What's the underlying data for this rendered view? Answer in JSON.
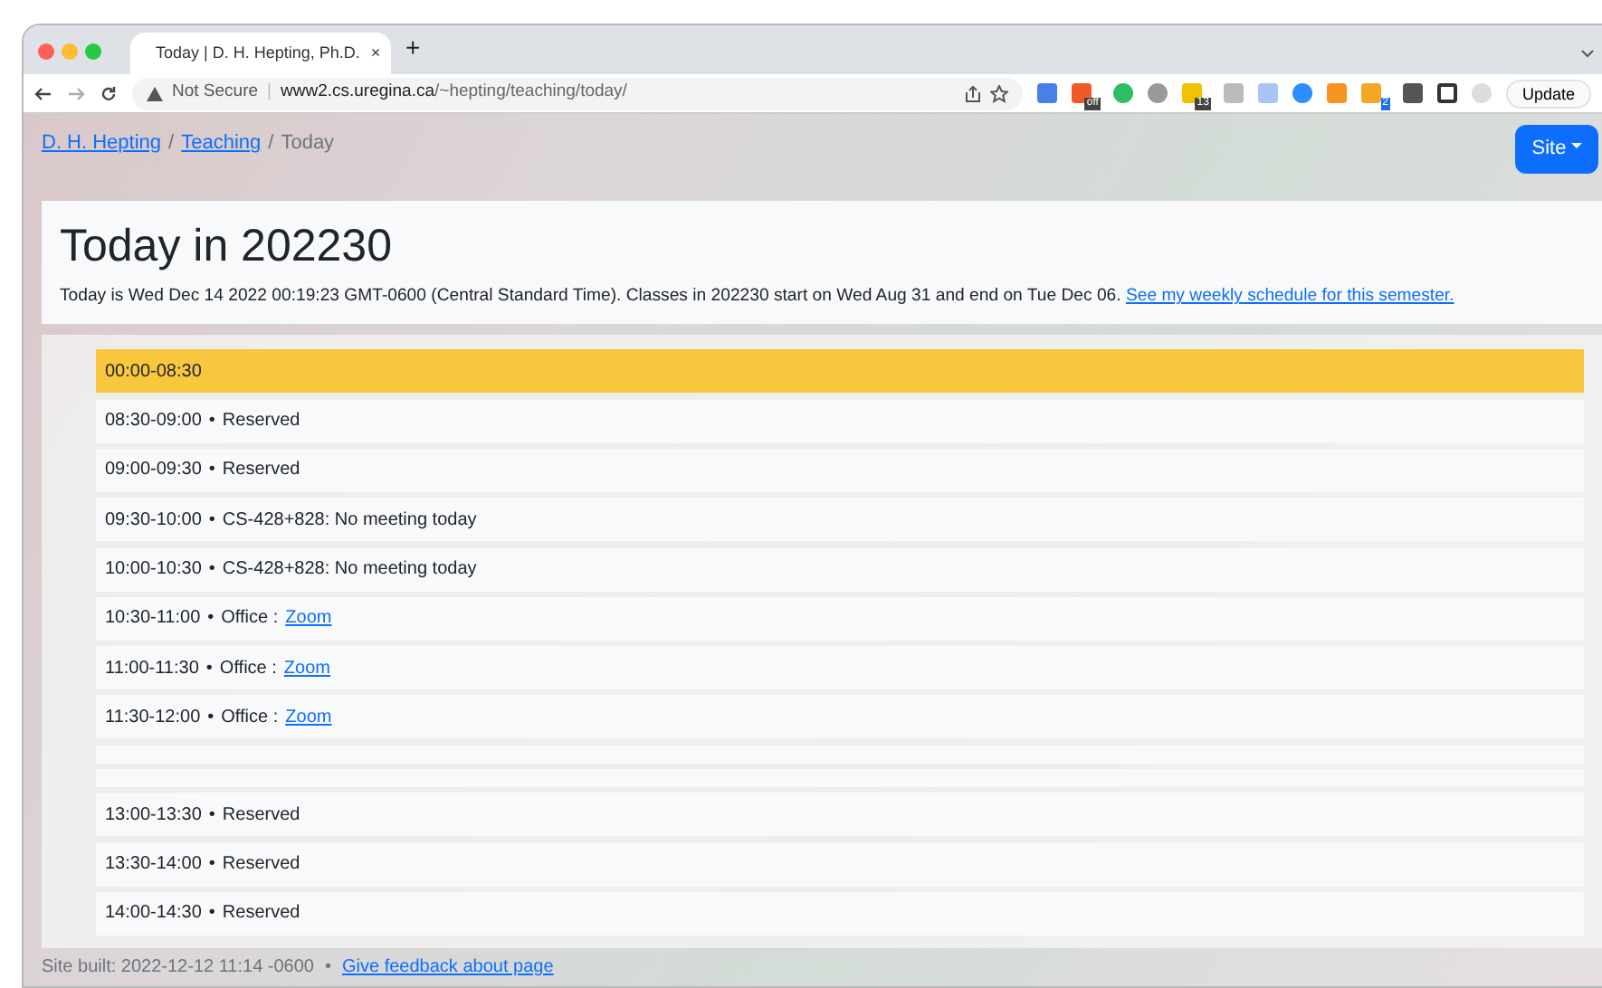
{
  "browser": {
    "tab_title": "Today | D. H. Hepting, Ph.D.",
    "tab_close": "×",
    "new_tab": "+",
    "security": "Not Secure",
    "url_divider": "|",
    "url_host": "www2.cs.uregina.ca",
    "url_path": "/~hepting/teaching/today/",
    "extension_badges": [
      "off",
      "13",
      "2"
    ],
    "update_button": "Update"
  },
  "breadcrumb_separator": "/",
  "slot_separator": "•",
  "breadcrumb": [
    {
      "label": "D. H. Hepting",
      "link": true
    },
    {
      "label": "Teaching",
      "link": true
    },
    {
      "label": "Today",
      "link": false
    }
  ],
  "site_button": "Site",
  "header": {
    "title": "Today in 202230",
    "text": "Today is Wed Dec 14 2022 00:19:23 GMT-0600 (Central Standard Time). Classes in 202230 start on Wed Aug 31 and end on Tue Dec 06.",
    "link": "See my weekly schedule for this semester."
  },
  "slots": [
    {
      "kind": "slot",
      "time": "00:00-08:30",
      "selected": true
    },
    {
      "kind": "slot",
      "time": "08:30-09:00",
      "label": "Reserved",
      "selected": false
    },
    {
      "kind": "slot",
      "time": "09:00-09:30",
      "label": "Reserved",
      "selected": false
    },
    {
      "kind": "slot",
      "time": "09:30-10:00",
      "label": "CS-428+828: No meeting today",
      "selected": false
    },
    {
      "kind": "slot",
      "time": "10:00-10:30",
      "label": "CS-428+828: No meeting today",
      "selected": false
    },
    {
      "kind": "slot",
      "time": "10:30-11:00",
      "label": "Office :",
      "link": "Zoom",
      "selected": false
    },
    {
      "kind": "slot",
      "time": "11:00-11:30",
      "label": "Office :",
      "link": "Zoom",
      "selected": false
    },
    {
      "kind": "slot",
      "time": "11:30-12:00",
      "label": "Office :",
      "link": "Zoom",
      "selected": false
    },
    {
      "kind": "blank",
      "selected": false
    },
    {
      "kind": "blank",
      "selected": false
    },
    {
      "kind": "slot",
      "time": "13:00-13:30",
      "label": "Reserved",
      "selected": false
    },
    {
      "kind": "slot",
      "time": "13:30-14:00",
      "label": "Reserved",
      "selected": false
    },
    {
      "kind": "slot",
      "time": "14:00-14:30",
      "label": "Reserved",
      "selected": false
    }
  ],
  "footer": {
    "text": "Site built: 2022-12-12 11:14 -0600",
    "separator": "•",
    "link": "Give feedback about page"
  }
}
